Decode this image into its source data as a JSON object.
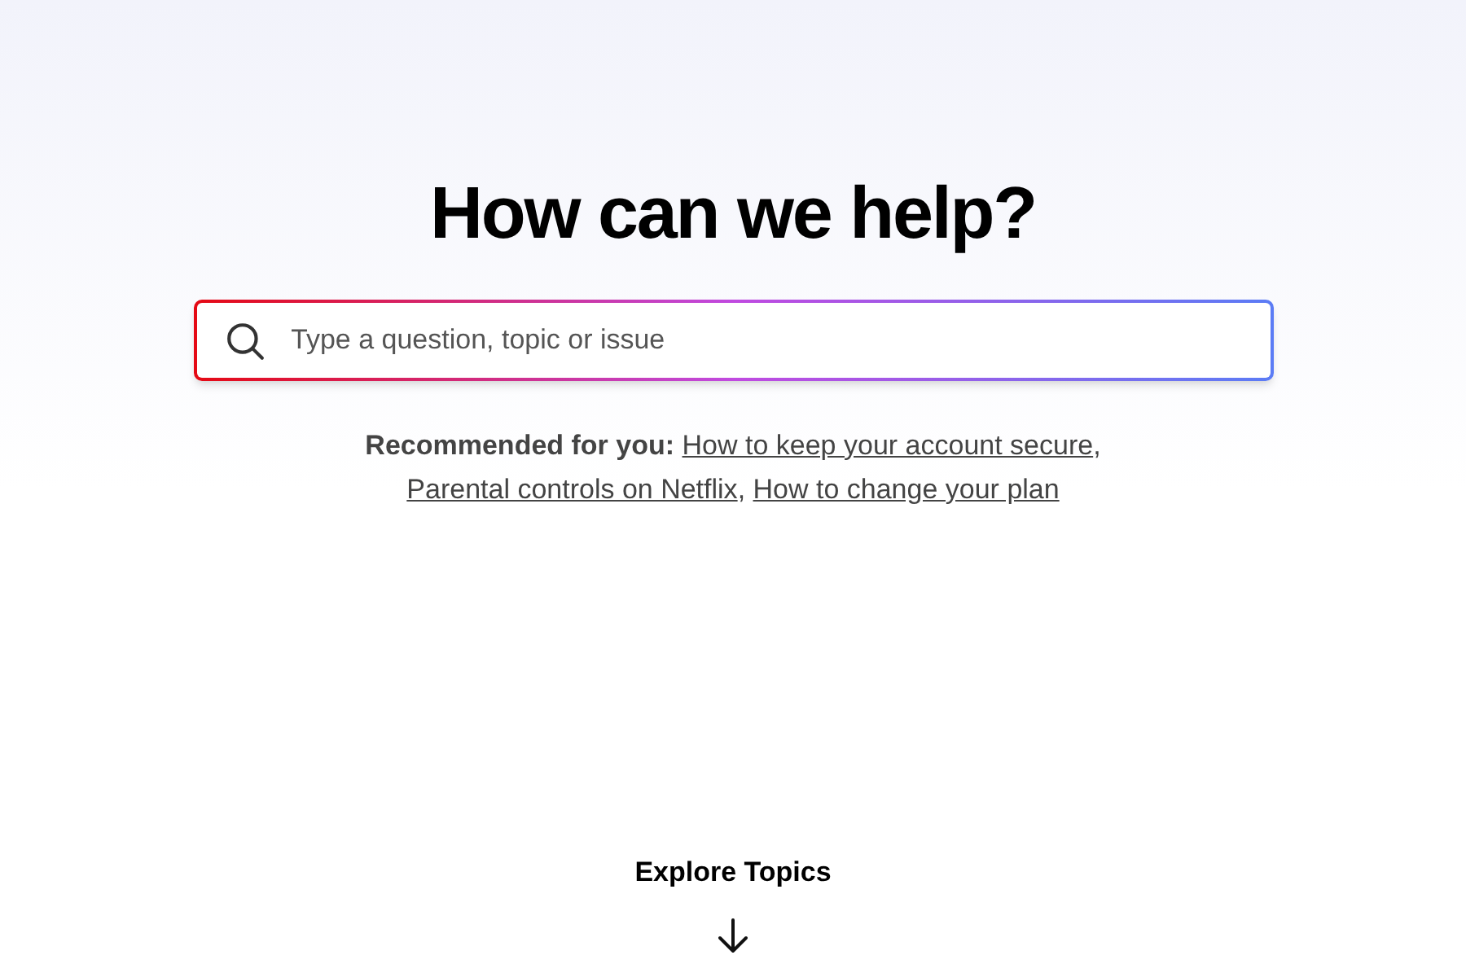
{
  "heading": "How can we help?",
  "search": {
    "placeholder": "Type a question, topic or issue"
  },
  "recommended": {
    "label": "Recommended for you:",
    "separator": ",",
    "links": [
      "How to keep your account secure",
      "Parental controls on Netflix",
      "How to change your plan"
    ]
  },
  "explore": {
    "label": "Explore Topics"
  }
}
